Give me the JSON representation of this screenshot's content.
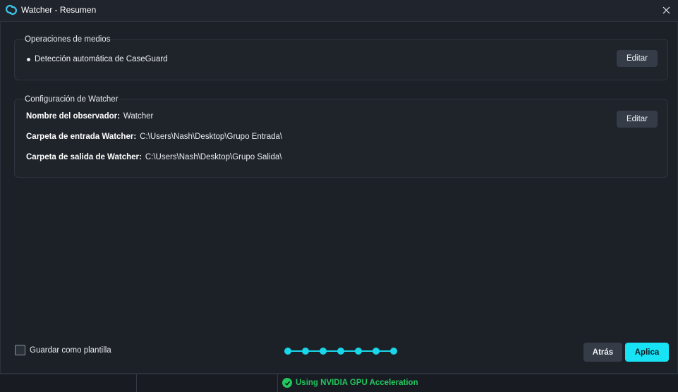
{
  "window": {
    "title": "Watcher - Resumen",
    "logo_icon": "caseguard-logo-icon",
    "close_icon": "close-icon"
  },
  "media_operations": {
    "title": "Operaciones de medios",
    "items": [
      "Detección automática de CaseGuard"
    ],
    "edit_label": "Editar"
  },
  "watcher_config": {
    "title": "Configuración de Watcher",
    "edit_label": "Editar",
    "fields": [
      {
        "label": "Nombre del observador:",
        "value": "Watcher"
      },
      {
        "label": "Carpeta de entrada Watcher:",
        "value": "C:\\Users\\Nash\\Desktop\\Grupo Entrada\\"
      },
      {
        "label": "Carpeta de salida de Watcher:",
        "value": "C:\\Users\\Nash\\Desktop\\Grupo Salida\\"
      }
    ]
  },
  "footer": {
    "save_template_label": "Guardar como plantilla",
    "save_template_checked": false,
    "steps_total": 7,
    "steps_completed": 7,
    "back_label": "Atrás",
    "apply_label": "Aplica"
  },
  "statusbar": {
    "gpu_message": "Using NVIDIA GPU Acceleration",
    "status_icon": "check-circle-icon"
  },
  "colors": {
    "accent": "#17e3f5",
    "status_ok": "#22c55e",
    "background": "#1c2128",
    "button": "#353c47"
  }
}
